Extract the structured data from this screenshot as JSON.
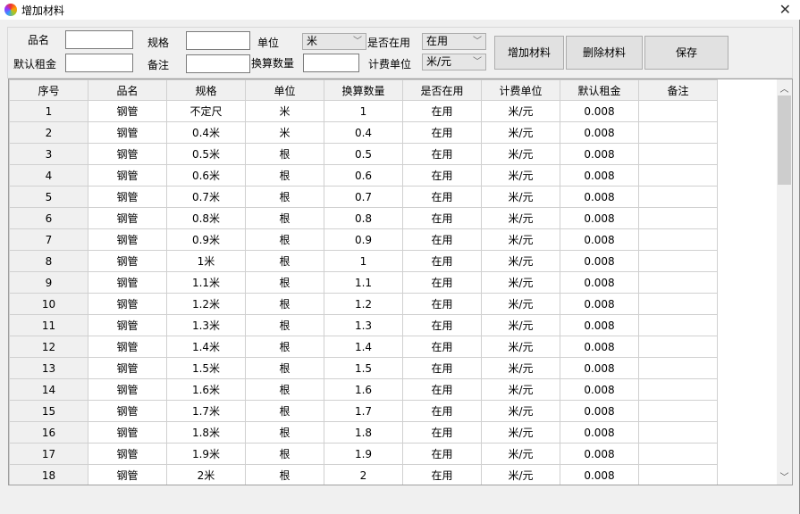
{
  "window": {
    "title": "增加材料",
    "close": "✕"
  },
  "form": {
    "name_label": "品名",
    "name_value": "",
    "spec_label": "规格",
    "spec_value": "",
    "unit_label": "单位",
    "unit_value": "米",
    "inuse_label": "是否在用",
    "inuse_value": "在用",
    "rent_label": "默认租金",
    "rent_value": "",
    "note_label": "备注",
    "note_value": "",
    "conv_label": "换算数量",
    "conv_value": "",
    "billing_label": "计费单位",
    "billing_value": "米/元"
  },
  "buttons": {
    "add": "增加材料",
    "delete": "删除材料",
    "save": "保存"
  },
  "table": {
    "headers": [
      "序号",
      "品名",
      "规格",
      "单位",
      "换算数量",
      "是否在用",
      "计费单位",
      "默认租金",
      "备注"
    ],
    "rows": [
      [
        "1",
        "钢管",
        "不定尺",
        "米",
        "1",
        "在用",
        "米/元",
        "0.008",
        ""
      ],
      [
        "2",
        "钢管",
        "0.4米",
        "米",
        "0.4",
        "在用",
        "米/元",
        "0.008",
        ""
      ],
      [
        "3",
        "钢管",
        "0.5米",
        "根",
        "0.5",
        "在用",
        "米/元",
        "0.008",
        ""
      ],
      [
        "4",
        "钢管",
        "0.6米",
        "根",
        "0.6",
        "在用",
        "米/元",
        "0.008",
        ""
      ],
      [
        "5",
        "钢管",
        "0.7米",
        "根",
        "0.7",
        "在用",
        "米/元",
        "0.008",
        ""
      ],
      [
        "6",
        "钢管",
        "0.8米",
        "根",
        "0.8",
        "在用",
        "米/元",
        "0.008",
        ""
      ],
      [
        "7",
        "钢管",
        "0.9米",
        "根",
        "0.9",
        "在用",
        "米/元",
        "0.008",
        ""
      ],
      [
        "8",
        "钢管",
        "1米",
        "根",
        "1",
        "在用",
        "米/元",
        "0.008",
        ""
      ],
      [
        "9",
        "钢管",
        "1.1米",
        "根",
        "1.1",
        "在用",
        "米/元",
        "0.008",
        ""
      ],
      [
        "10",
        "钢管",
        "1.2米",
        "根",
        "1.2",
        "在用",
        "米/元",
        "0.008",
        ""
      ],
      [
        "11",
        "钢管",
        "1.3米",
        "根",
        "1.3",
        "在用",
        "米/元",
        "0.008",
        ""
      ],
      [
        "12",
        "钢管",
        "1.4米",
        "根",
        "1.4",
        "在用",
        "米/元",
        "0.008",
        ""
      ],
      [
        "13",
        "钢管",
        "1.5米",
        "根",
        "1.5",
        "在用",
        "米/元",
        "0.008",
        ""
      ],
      [
        "14",
        "钢管",
        "1.6米",
        "根",
        "1.6",
        "在用",
        "米/元",
        "0.008",
        ""
      ],
      [
        "15",
        "钢管",
        "1.7米",
        "根",
        "1.7",
        "在用",
        "米/元",
        "0.008",
        ""
      ],
      [
        "16",
        "钢管",
        "1.8米",
        "根",
        "1.8",
        "在用",
        "米/元",
        "0.008",
        ""
      ],
      [
        "17",
        "钢管",
        "1.9米",
        "根",
        "1.9",
        "在用",
        "米/元",
        "0.008",
        ""
      ],
      [
        "18",
        "钢管",
        "2米",
        "根",
        "2",
        "在用",
        "米/元",
        "0.008",
        ""
      ]
    ]
  }
}
